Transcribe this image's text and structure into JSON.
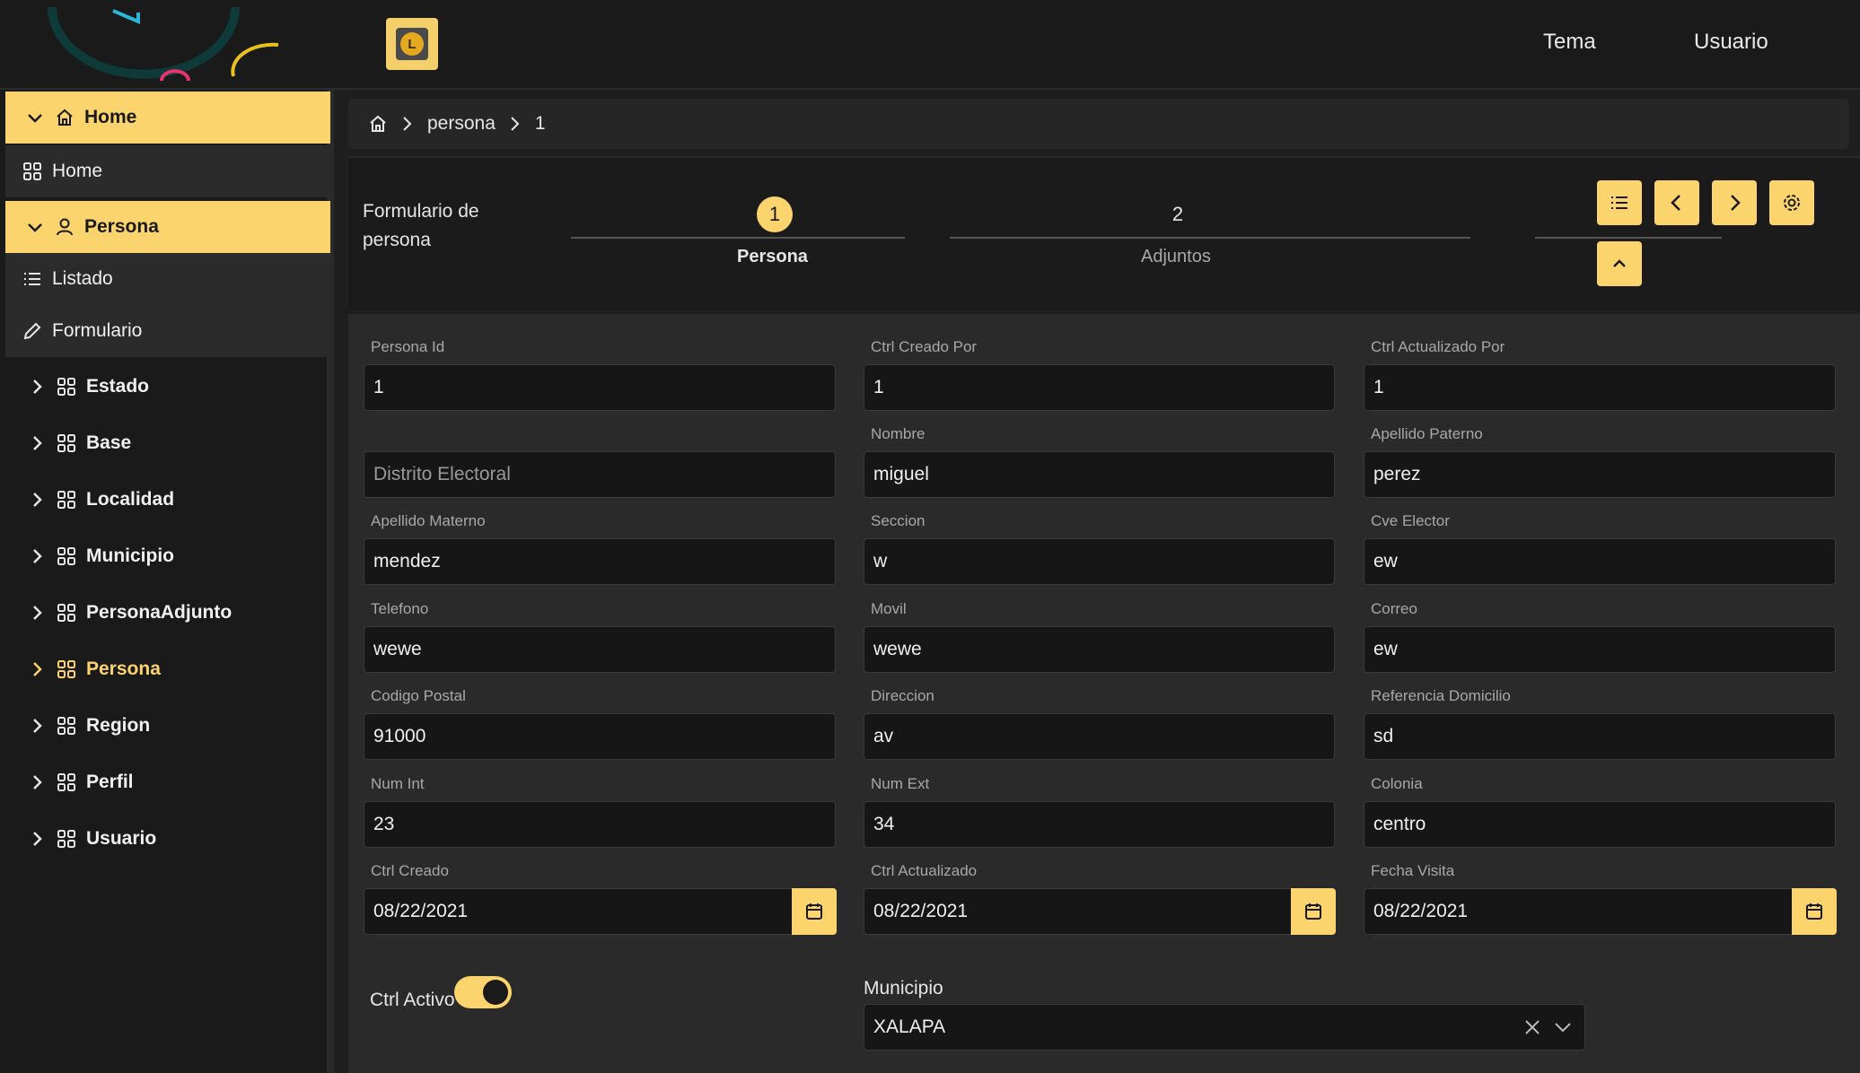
{
  "colors": {
    "accent": "#fbd46d",
    "background": "#1e1e1e",
    "sidebar": "#1a1a1a",
    "input": "#161616"
  },
  "topbar": {
    "tema_label": "Tema",
    "usuario_label": "Usuario"
  },
  "sidebar": {
    "home_group": "Home",
    "home_item": "Home",
    "persona_group": "Persona",
    "listado": "Listado",
    "formulario": "Formulario",
    "groups": [
      "Estado",
      "Base",
      "Localidad",
      "Municipio",
      "PersonaAdjunto",
      "Persona",
      "Region",
      "Perfil",
      "Usuario"
    ]
  },
  "breadcrumb": {
    "segment1": "persona",
    "segment2": "1"
  },
  "header": {
    "title": "Formulario de persona",
    "steps": [
      {
        "number": "1",
        "label": "Persona"
      },
      {
        "number": "2",
        "label": "Adjuntos"
      }
    ]
  },
  "form": {
    "persona_id": {
      "label": "Persona Id",
      "value": "1"
    },
    "ctrl_creado_por": {
      "label": "Ctrl Creado Por",
      "value": "1"
    },
    "ctrl_actualizado_por": {
      "label": "Ctrl Actualizado Por",
      "value": "1"
    },
    "distrito_electoral": {
      "placeholder": "Distrito Electoral"
    },
    "nombre": {
      "label": "Nombre",
      "value": "miguel"
    },
    "apellido_paterno": {
      "label": "Apellido Paterno",
      "value": "perez"
    },
    "apellido_materno": {
      "label": "Apellido Materno",
      "value": "mendez"
    },
    "seccion": {
      "label": "Seccion",
      "value": "w"
    },
    "cve_elector": {
      "label": "Cve Elector",
      "value": "ew"
    },
    "telefono": {
      "label": "Telefono",
      "value": "wewe"
    },
    "movil": {
      "label": "Movil",
      "value": "wewe"
    },
    "correo": {
      "label": "Correo",
      "value": "ew"
    },
    "codigo_postal": {
      "label": "Codigo Postal",
      "value": "91000"
    },
    "direccion": {
      "label": "Direccion",
      "value": "av"
    },
    "referencia_domicilio": {
      "label": "Referencia Domicilio",
      "value": "sd"
    },
    "num_int": {
      "label": "Num Int",
      "value": "23"
    },
    "num_ext": {
      "label": "Num Ext",
      "value": "34"
    },
    "colonia": {
      "label": "Colonia",
      "value": "centro"
    },
    "ctrl_creado": {
      "label": "Ctrl Creado",
      "value": "08/22/2021"
    },
    "ctrl_actualizado": {
      "label": "Ctrl Actualizado",
      "value": "08/22/2021"
    },
    "fecha_visita": {
      "label": "Fecha Visita",
      "value": "08/22/2021"
    },
    "ctrl_activo": {
      "label": "Ctrl Activo",
      "checked": true
    },
    "municipio": {
      "label": "Municipio",
      "value": "XALAPA"
    }
  }
}
